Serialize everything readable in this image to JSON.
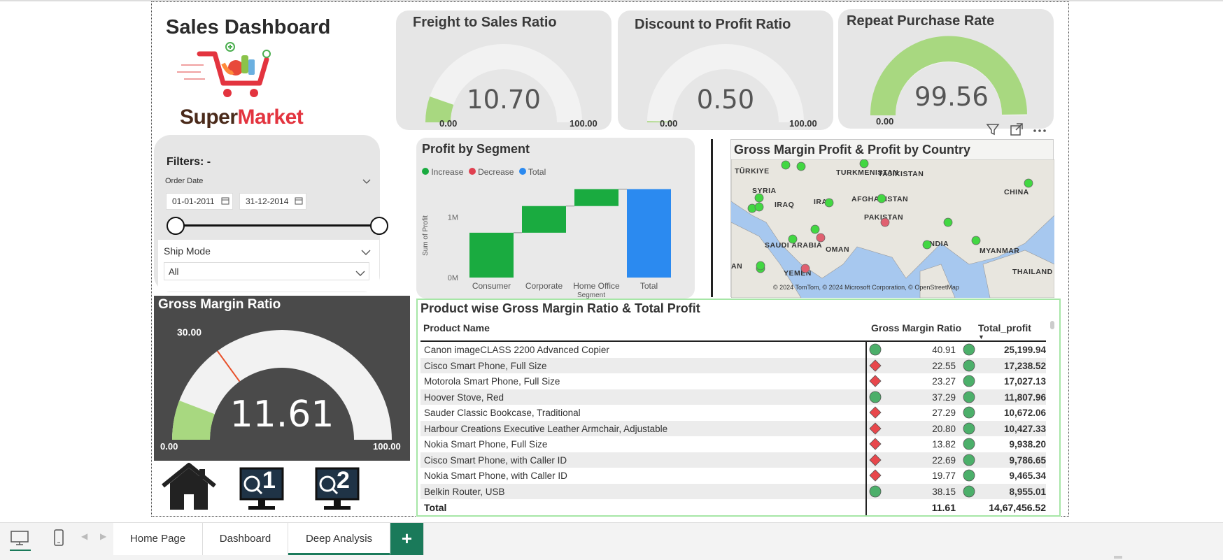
{
  "dashboard": {
    "title": "Sales Dashboard",
    "logo_text_1": "Super",
    "logo_text_2": "Market"
  },
  "gauges": [
    {
      "title": "Freight to Sales Ratio",
      "value": "10.70",
      "min": "0.00",
      "max": "100.00",
      "fraction": 0.107
    },
    {
      "title": "Discount to Profit Ratio",
      "value": "0.50",
      "min": "0.00",
      "max": "100.00",
      "fraction": 0.005
    },
    {
      "title": "Repeat Purchase Rate",
      "value": "99.56",
      "min": "0.00",
      "max": "100.00",
      "fraction": 0.9956
    }
  ],
  "filters": {
    "title": "Filters: -",
    "order_date_label": "Order Date",
    "date_from": "01-01-2011",
    "date_to": "31-12-2014",
    "ship_mode_label": "Ship Mode",
    "ship_mode_value": "All"
  },
  "gross_margin": {
    "title": "Gross Margin Ratio",
    "value": "11.61",
    "min": "0.00",
    "max": "100.00",
    "target": "30.00",
    "fraction": 0.1161,
    "target_fraction": 0.3
  },
  "nav_icons": [
    "home-icon",
    "deep-analysis-1-icon",
    "deep-analysis-2-icon"
  ],
  "nav_labels": {
    "n1": "1",
    "n2": "2"
  },
  "profit_by_segment": {
    "title": "Profit by Segment",
    "legend": [
      "Increase",
      "Decrease",
      "Total"
    ],
    "legend_colors": [
      "#1aab40",
      "#e04050",
      "#2b8af0"
    ],
    "ylabel": "Sum of Profit",
    "xlabel": "Segment",
    "yticks": [
      "0M",
      "1M"
    ]
  },
  "chart_data": {
    "type": "waterfall",
    "title": "Profit by Segment",
    "xlabel": "Segment",
    "ylabel": "Sum of Profit",
    "categories": [
      "Consumer",
      "Corporate",
      "Home Office",
      "Total"
    ],
    "values": [
      0.74,
      0.44,
      0.28,
      1.46
    ],
    "units": "M",
    "ylim": [
      0,
      1.5
    ],
    "yticks": [
      0,
      1
    ],
    "colors": {
      "increase": "#1aab40",
      "decrease": "#e04050",
      "total": "#2b8af0"
    }
  },
  "map": {
    "title": "Gross Margin Profit & Profit by Country",
    "labels": [
      "TÜRKIYE",
      "SYRIA",
      "IRAQ",
      "IRAN",
      "TURKMENISTAN",
      "TAJIKISTAN",
      "AFGHANISTAN",
      "PAKISTAN",
      "CHINA",
      "INDIA",
      "SAUDI ARABIA",
      "OMAN",
      "MYANMAR",
      "THAILAND",
      "YEMEN",
      "AN"
    ],
    "attribution": "© 2024 TomTom, © 2024 Microsoft Corporation, © OpenStreetMap"
  },
  "product_table": {
    "title": "Product wise Gross Margin Ratio & Total Profit",
    "columns": [
      "Product Name",
      "Gross Margin Ratio",
      "Total_profit"
    ],
    "rows": [
      {
        "name": "Canon imageCLASS 2200 Advanced Copier",
        "gmr": "40.91",
        "gmr_status": "good",
        "profit": "25,199.94"
      },
      {
        "name": "Cisco Smart Phone, Full Size",
        "gmr": "22.55",
        "gmr_status": "bad",
        "profit": "17,238.52"
      },
      {
        "name": "Motorola Smart Phone, Full Size",
        "gmr": "23.27",
        "gmr_status": "bad",
        "profit": "17,027.13"
      },
      {
        "name": "Hoover Stove, Red",
        "gmr": "37.29",
        "gmr_status": "good",
        "profit": "11,807.96"
      },
      {
        "name": "Sauder Classic Bookcase, Traditional",
        "gmr": "27.29",
        "gmr_status": "bad",
        "profit": "10,672.06"
      },
      {
        "name": "Harbour Creations Executive Leather Armchair, Adjustable",
        "gmr": "20.80",
        "gmr_status": "bad",
        "profit": "10,427.33"
      },
      {
        "name": "Nokia Smart Phone, Full Size",
        "gmr": "13.82",
        "gmr_status": "bad",
        "profit": "9,938.20"
      },
      {
        "name": "Cisco Smart Phone, with Caller ID",
        "gmr": "22.69",
        "gmr_status": "bad",
        "profit": "9,786.65"
      },
      {
        "name": "Nokia Smart Phone, with Caller ID",
        "gmr": "19.77",
        "gmr_status": "bad",
        "profit": "9,465.34"
      },
      {
        "name": "Belkin Router, USB",
        "gmr": "38.15",
        "gmr_status": "good",
        "profit": "8,955.01"
      }
    ],
    "total_label": "Total",
    "total_gmr": "11.61",
    "total_profit": "14,67,456.52"
  },
  "tabs": [
    "Home Page",
    "Dashboard",
    "Deep Analysis"
  ],
  "active_tab": "Deep Analysis",
  "add_tab_label": "+",
  "colors": {
    "gauge_fill": "#a8d880",
    "gauge_track": "#f2f2f2",
    "good": "#4caf6a",
    "bad": "#e8474c",
    "accent": "#1a7a5a"
  }
}
